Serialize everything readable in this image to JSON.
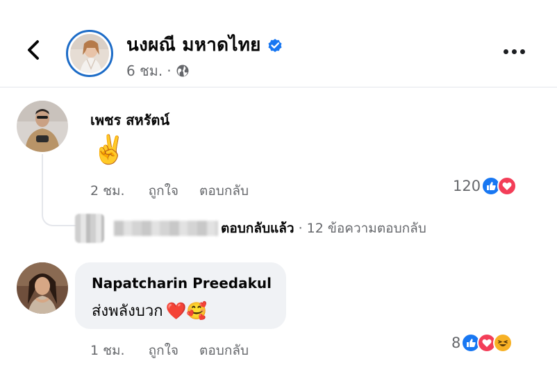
{
  "header": {
    "back_label": "<",
    "page_name": "นงผณี มหาดไทย",
    "time": "6 ชม.",
    "separator": "·",
    "verified_icon": "verified-badge-icon",
    "privacy_icon": "globe-icon",
    "more_icon": "more-horizontal-icon"
  },
  "comments": [
    {
      "author": "เพชร สหรัตน์",
      "text": "✌️",
      "time": "2 ชม.",
      "like_label": "ถูกใจ",
      "reply_label": "ตอบกลับ",
      "reaction_count": "120",
      "reactions": [
        "like",
        "love"
      ]
    },
    {
      "author": "Napatcharin Preedakul",
      "text": "ส่งพลังบวก",
      "emojis": "❤️🥰",
      "time": "1 ชม.",
      "like_label": "ถูกใจ",
      "reply_label": "ตอบกลับ",
      "reaction_count": "8",
      "reactions": [
        "like",
        "love",
        "haha"
      ]
    }
  ],
  "reply_summary": {
    "replied_label": "ตอบกลับแล้ว",
    "separator": "·",
    "count_label": "12 ข้อความตอบกลับ"
  },
  "colors": {
    "like_blue": "#1877f2",
    "love_red": "#f33e58",
    "haha_yellow": "#f7b125",
    "avatar_ring": "#1d6cc7",
    "muted_text": "#65676b",
    "bubble_bg": "#f0f2f5"
  }
}
